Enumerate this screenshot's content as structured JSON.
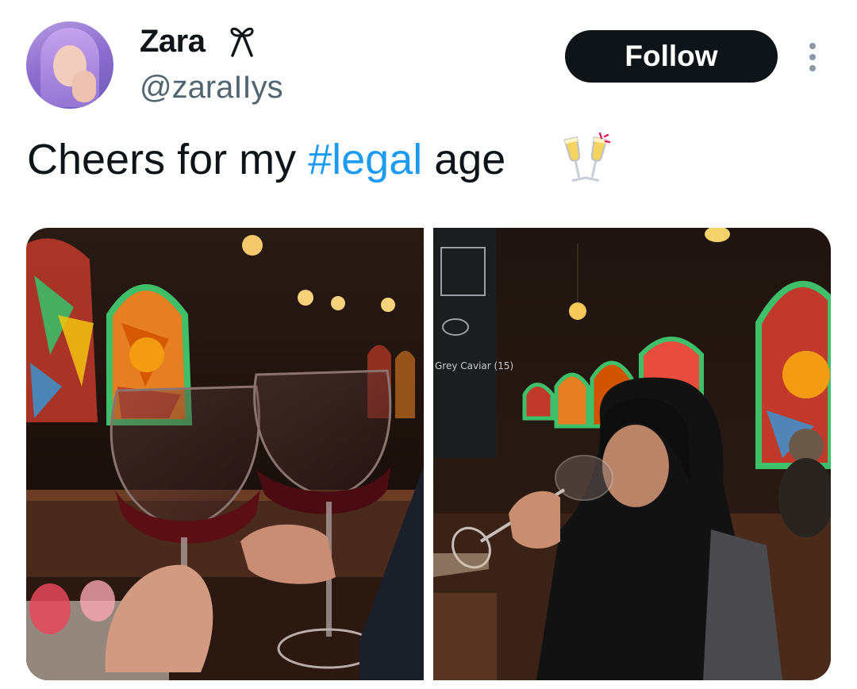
{
  "tweet": {
    "author": {
      "display_name": "Zara",
      "handle": "@zaraIIys",
      "name_emoji": "ribbon-icon",
      "avatar": "profile-photo-purple-hijab"
    },
    "follow_label": "Follow",
    "more_icon": "more-vertical-icon",
    "text_before": "Cheers for my ",
    "hashtag": "#legal",
    "text_after": " age",
    "text_emoji": "clinking-glasses-icon",
    "colors": {
      "text": "#0f1419",
      "secondary": "#536471",
      "link": "#1d9bf0",
      "button_bg": "#0f1419",
      "button_text": "#ffffff"
    },
    "media": [
      {
        "description_name": "photo-clinking-wine-glasses"
      },
      {
        "description_name": "photo-woman-drinking-wine"
      }
    ],
    "photo_signs": {
      "menu_line": "Grey Caviar (15)"
    }
  }
}
